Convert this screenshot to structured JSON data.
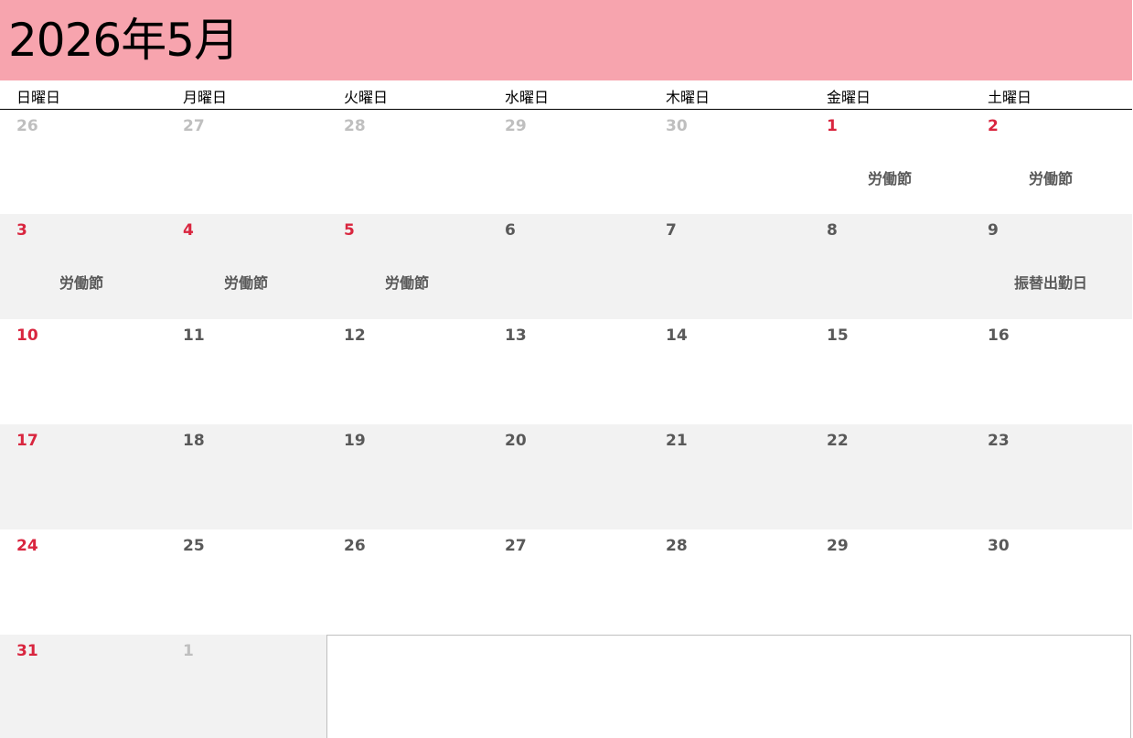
{
  "title": "2026年5月",
  "weekdays": [
    "日曜日",
    "月曜日",
    "火曜日",
    "水曜日",
    "木曜日",
    "金曜日",
    "土曜日"
  ],
  "weeks": [
    [
      {
        "day": "26",
        "type": "other-month",
        "note": ""
      },
      {
        "day": "27",
        "type": "other-month",
        "note": ""
      },
      {
        "day": "28",
        "type": "other-month",
        "note": ""
      },
      {
        "day": "29",
        "type": "other-month",
        "note": ""
      },
      {
        "day": "30",
        "type": "other-month",
        "note": ""
      },
      {
        "day": "1",
        "type": "holiday",
        "note": "労働節"
      },
      {
        "day": "2",
        "type": "holiday",
        "note": "労働節"
      }
    ],
    [
      {
        "day": "3",
        "type": "sunday",
        "note": "労働節"
      },
      {
        "day": "4",
        "type": "holiday",
        "note": "労働節"
      },
      {
        "day": "5",
        "type": "holiday",
        "note": "労働節"
      },
      {
        "day": "6",
        "type": "normal",
        "note": ""
      },
      {
        "day": "7",
        "type": "normal",
        "note": ""
      },
      {
        "day": "8",
        "type": "normal",
        "note": ""
      },
      {
        "day": "9",
        "type": "normal",
        "note": "振替出勤日"
      }
    ],
    [
      {
        "day": "10",
        "type": "sunday",
        "note": ""
      },
      {
        "day": "11",
        "type": "normal",
        "note": ""
      },
      {
        "day": "12",
        "type": "normal",
        "note": ""
      },
      {
        "day": "13",
        "type": "normal",
        "note": ""
      },
      {
        "day": "14",
        "type": "normal",
        "note": ""
      },
      {
        "day": "15",
        "type": "normal",
        "note": ""
      },
      {
        "day": "16",
        "type": "normal",
        "note": ""
      }
    ],
    [
      {
        "day": "17",
        "type": "sunday",
        "note": ""
      },
      {
        "day": "18",
        "type": "normal",
        "note": ""
      },
      {
        "day": "19",
        "type": "normal",
        "note": ""
      },
      {
        "day": "20",
        "type": "normal",
        "note": ""
      },
      {
        "day": "21",
        "type": "normal",
        "note": ""
      },
      {
        "day": "22",
        "type": "normal",
        "note": ""
      },
      {
        "day": "23",
        "type": "normal",
        "note": ""
      }
    ],
    [
      {
        "day": "24",
        "type": "sunday",
        "note": ""
      },
      {
        "day": "25",
        "type": "normal",
        "note": ""
      },
      {
        "day": "26",
        "type": "normal",
        "note": ""
      },
      {
        "day": "27",
        "type": "normal",
        "note": ""
      },
      {
        "day": "28",
        "type": "normal",
        "note": ""
      },
      {
        "day": "29",
        "type": "normal",
        "note": ""
      },
      {
        "day": "30",
        "type": "normal",
        "note": ""
      }
    ],
    [
      {
        "day": "31",
        "type": "sunday",
        "note": ""
      },
      {
        "day": "1",
        "type": "other-month",
        "note": ""
      }
    ]
  ],
  "colors": {
    "header_bg": "#f7a4ae",
    "holiday_red": "#d9263f",
    "day_gray": "#595959",
    "other_month_gray": "#bfbfbf",
    "shaded_row": "#f2f2f2"
  }
}
